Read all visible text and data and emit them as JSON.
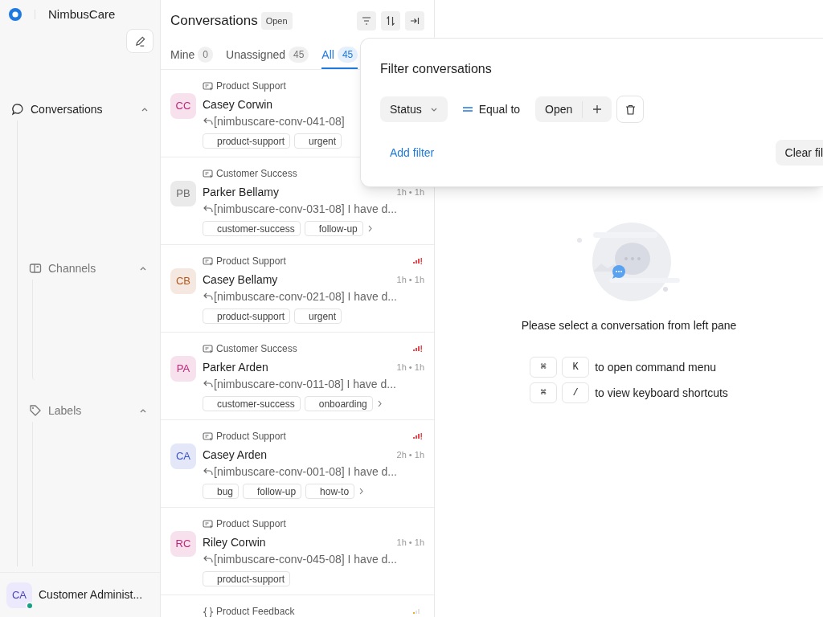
{
  "brand": {
    "name": "NimbusCare"
  },
  "sidebar": {
    "sections": [
      {
        "label": "Conversations",
        "expanded": true,
        "children": [
          {
            "label": "Channels",
            "expanded": true
          },
          {
            "label": "Labels",
            "expanded": true
          }
        ]
      }
    ],
    "user": {
      "initials": "CA",
      "name": "Customer Administ...",
      "online": true
    }
  },
  "list": {
    "title": "Conversations",
    "status_badge": "Open",
    "tabs": [
      {
        "label": "Mine",
        "count": "0",
        "selected": false
      },
      {
        "label": "Unassigned",
        "count": "45",
        "selected": false
      },
      {
        "label": "All",
        "count": "45",
        "selected": true
      }
    ],
    "conversations": [
      {
        "kind": "website",
        "inbox": "Product Support",
        "initials": "CC",
        "color": "#c0267a",
        "name": "Casey Corwin",
        "preview": "[nimbuscare-conv-041-08]",
        "labels": [
          "product-support",
          "urgent"
        ],
        "has_more": false
      },
      {
        "kind": "website",
        "inbox": "Customer Success",
        "initials": "PB",
        "color": "#6b6b6b",
        "name": "Parker Bellamy",
        "time": "1h • 1h",
        "preview": "[nimbuscare-conv-031-08] I have d...",
        "labels": [
          "customer-success",
          "follow-up"
        ],
        "has_more": true
      },
      {
        "kind": "website",
        "inbox": "Product Support",
        "initials": "CB",
        "color": "#b4581e",
        "name": "Casey Bellamy",
        "priority_icon": {
          "kind": "urgent"
        },
        "time": "1h • 1h",
        "preview": "[nimbuscare-conv-021-08] I have d...",
        "labels": [
          "product-support",
          "urgent"
        ],
        "has_more": false
      },
      {
        "kind": "website",
        "inbox": "Customer Success",
        "initials": "PA",
        "color": "#c0267a",
        "name": "Parker Arden",
        "priority_icon": {
          "kind": "urgent"
        },
        "time": "1h • 1h",
        "preview": "[nimbuscare-conv-011-08] I have d...",
        "labels": [
          "customer-success",
          "onboarding"
        ],
        "has_more": true
      },
      {
        "kind": "website",
        "inbox": "Product Support",
        "initials": "CA",
        "color": "#3b55c9",
        "name": "Casey Arden",
        "priority_icon": {
          "kind": "urgent"
        },
        "time": "2h • 1h",
        "preview": "[nimbuscare-conv-001-08] I have d...",
        "labels": [
          "bug",
          "follow-up",
          "how-to"
        ],
        "has_more": true
      },
      {
        "kind": "website",
        "inbox": "Product Support",
        "initials": "RC",
        "color": "#c0267a",
        "name": "Riley Corwin",
        "time": "1h • 1h",
        "preview": "[nimbuscare-conv-045-08] I have d...",
        "labels": [
          "product-support"
        ],
        "has_more": false
      },
      {
        "kind": "api",
        "inbox": "Product Feedback",
        "priority_icon": {
          "kind": "low"
        }
      }
    ]
  },
  "filter_popover": {
    "title": "Filter conversations",
    "filters": [
      {
        "attribute": "Status",
        "operator": "Equal to",
        "value": "Open"
      }
    ],
    "add_filter": "Add filter",
    "clear_button": "Clear fil"
  },
  "empty_state": {
    "message": "Please select a conversation from left pane",
    "shortcuts": [
      {
        "keys": [
          "⌘",
          "K"
        ],
        "description": "to open command menu"
      },
      {
        "keys": [
          "⌘",
          "/"
        ],
        "description": "to view keyboard shortcuts"
      }
    ]
  }
}
